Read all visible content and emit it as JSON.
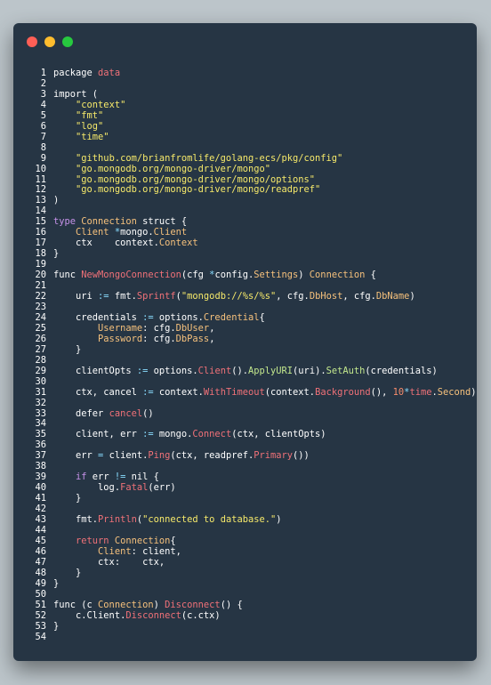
{
  "window": {
    "controls": [
      "close",
      "minimize",
      "maximize"
    ],
    "colors": {
      "close": "#ff5f56",
      "minimize": "#ffbd2e",
      "maximize": "#27c93f",
      "background": "#263544"
    }
  },
  "code_lines": [
    [
      [
        "w",
        "package "
      ],
      [
        "f",
        "data"
      ]
    ],
    [],
    [
      [
        "w",
        "import ("
      ]
    ],
    [
      [
        "w",
        "    "
      ],
      [
        "s",
        "\"context\""
      ]
    ],
    [
      [
        "w",
        "    "
      ],
      [
        "s",
        "\"fmt\""
      ]
    ],
    [
      [
        "w",
        "    "
      ],
      [
        "s",
        "\"log\""
      ]
    ],
    [
      [
        "w",
        "    "
      ],
      [
        "s",
        "\"time\""
      ]
    ],
    [],
    [
      [
        "w",
        "    "
      ],
      [
        "s",
        "\"github.com/brianfromlife/golang-ecs/pkg/config\""
      ]
    ],
    [
      [
        "w",
        "    "
      ],
      [
        "s",
        "\"go.mongodb.org/mongo-driver/mongo\""
      ]
    ],
    [
      [
        "w",
        "    "
      ],
      [
        "s",
        "\"go.mongodb.org/mongo-driver/mongo/options\""
      ]
    ],
    [
      [
        "w",
        "    "
      ],
      [
        "s",
        "\"go.mongodb.org/mongo-driver/mongo/readpref\""
      ]
    ],
    [
      [
        "w",
        ")"
      ]
    ],
    [],
    [
      [
        "k",
        "type "
      ],
      [
        "t",
        "Connection"
      ],
      [
        "w",
        " struct {"
      ]
    ],
    [
      [
        "w",
        "    "
      ],
      [
        "t",
        "Client"
      ],
      [
        "w",
        " "
      ],
      [
        "o",
        "*"
      ],
      [
        "w",
        "mongo."
      ],
      [
        "t",
        "Client"
      ]
    ],
    [
      [
        "w",
        "    ctx    context."
      ],
      [
        "t",
        "Context"
      ]
    ],
    [
      [
        "w",
        "}"
      ]
    ],
    [],
    [
      [
        "w",
        "func "
      ],
      [
        "f",
        "NewMongoConnection"
      ],
      [
        "w",
        "(cfg "
      ],
      [
        "o",
        "*"
      ],
      [
        "w",
        "config."
      ],
      [
        "t",
        "Settings"
      ],
      [
        "w",
        ") "
      ],
      [
        "t",
        "Connection"
      ],
      [
        "w",
        " {"
      ]
    ],
    [],
    [
      [
        "w",
        "    uri "
      ],
      [
        "o",
        ":="
      ],
      [
        "w",
        " fmt."
      ],
      [
        "f",
        "Sprintf"
      ],
      [
        "w",
        "("
      ],
      [
        "s",
        "\"mongodb://%s/%s\""
      ],
      [
        "w",
        ", cfg."
      ],
      [
        "t",
        "DbHost"
      ],
      [
        "w",
        ", cfg."
      ],
      [
        "t",
        "DbName"
      ],
      [
        "w",
        ")"
      ]
    ],
    [],
    [
      [
        "w",
        "    credentials "
      ],
      [
        "o",
        ":="
      ],
      [
        "w",
        " options."
      ],
      [
        "t",
        "Credential"
      ],
      [
        "w",
        "{"
      ]
    ],
    [
      [
        "w",
        "        "
      ],
      [
        "t",
        "Username"
      ],
      [
        "w",
        ": cfg."
      ],
      [
        "t",
        "DbUser"
      ],
      [
        "w",
        ","
      ]
    ],
    [
      [
        "w",
        "        "
      ],
      [
        "t",
        "Password"
      ],
      [
        "w",
        ": cfg."
      ],
      [
        "t",
        "DbPass"
      ],
      [
        "w",
        ","
      ]
    ],
    [
      [
        "w",
        "    }"
      ]
    ],
    [],
    [
      [
        "w",
        "    clientOpts "
      ],
      [
        "o",
        ":="
      ],
      [
        "w",
        " options."
      ],
      [
        "f",
        "Client"
      ],
      [
        "w",
        "()."
      ],
      [
        "m",
        "ApplyURI"
      ],
      [
        "w",
        "(uri)."
      ],
      [
        "m",
        "SetAuth"
      ],
      [
        "w",
        "(credentials)"
      ]
    ],
    [],
    [
      [
        "w",
        "    ctx, cancel "
      ],
      [
        "o",
        ":="
      ],
      [
        "w",
        " context."
      ],
      [
        "f",
        "WithTimeout"
      ],
      [
        "w",
        "(context."
      ],
      [
        "f",
        "Background"
      ],
      [
        "w",
        "(), "
      ],
      [
        "n",
        "10"
      ],
      [
        "o",
        "*"
      ],
      [
        "f",
        "time"
      ],
      [
        "w",
        "."
      ],
      [
        "t",
        "Second"
      ],
      [
        "w",
        ")"
      ]
    ],
    [],
    [
      [
        "w",
        "    defer "
      ],
      [
        "f",
        "cancel"
      ],
      [
        "w",
        "()"
      ]
    ],
    [],
    [
      [
        "w",
        "    client, err "
      ],
      [
        "o",
        ":="
      ],
      [
        "w",
        " mongo."
      ],
      [
        "f",
        "Connect"
      ],
      [
        "w",
        "(ctx, clientOpts)"
      ]
    ],
    [],
    [
      [
        "w",
        "    err "
      ],
      [
        "o",
        "="
      ],
      [
        "w",
        " client."
      ],
      [
        "f",
        "Ping"
      ],
      [
        "w",
        "(ctx, readpref."
      ],
      [
        "f",
        "Primary"
      ],
      [
        "w",
        "())"
      ]
    ],
    [],
    [
      [
        "w",
        "    "
      ],
      [
        "k",
        "if"
      ],
      [
        "w",
        " err "
      ],
      [
        "o",
        "!="
      ],
      [
        "w",
        " nil {"
      ]
    ],
    [
      [
        "w",
        "        log."
      ],
      [
        "f",
        "Fatal"
      ],
      [
        "w",
        "(err)"
      ]
    ],
    [
      [
        "w",
        "    }"
      ]
    ],
    [],
    [
      [
        "w",
        "    fmt."
      ],
      [
        "f",
        "Println"
      ],
      [
        "w",
        "("
      ],
      [
        "s",
        "\"connected to database.\""
      ],
      [
        "w",
        ")"
      ]
    ],
    [],
    [
      [
        "w",
        "    "
      ],
      [
        "f",
        "return"
      ],
      [
        "w",
        " "
      ],
      [
        "t",
        "Connection"
      ],
      [
        "w",
        "{"
      ]
    ],
    [
      [
        "w",
        "        "
      ],
      [
        "t",
        "Client"
      ],
      [
        "w",
        ": client,"
      ]
    ],
    [
      [
        "w",
        "        ctx:    ctx,"
      ]
    ],
    [
      [
        "w",
        "    }"
      ]
    ],
    [
      [
        "w",
        "}"
      ]
    ],
    [],
    [
      [
        "w",
        "func (c "
      ],
      [
        "t",
        "Connection"
      ],
      [
        "w",
        ") "
      ],
      [
        "f",
        "Disconnect"
      ],
      [
        "w",
        "() {"
      ]
    ],
    [
      [
        "w",
        "    c.Client."
      ],
      [
        "f",
        "Disconnect"
      ],
      [
        "w",
        "(c.ctx)"
      ]
    ],
    [
      [
        "w",
        "}"
      ]
    ],
    []
  ]
}
